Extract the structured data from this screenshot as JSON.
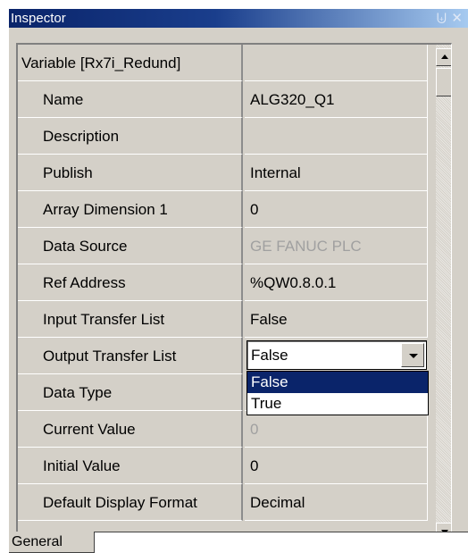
{
  "window": {
    "title": "Inspector",
    "pin_icon": "pin-icon",
    "close_icon": "close-icon"
  },
  "grid": {
    "rows": [
      {
        "name": "Variable [Rx7i_Redund]",
        "value": "",
        "indent": false,
        "disabled": false
      },
      {
        "name": "Name",
        "value": "ALG320_Q1",
        "indent": true,
        "disabled": false
      },
      {
        "name": "Description",
        "value": "",
        "indent": true,
        "disabled": false
      },
      {
        "name": "Publish",
        "value": "Internal",
        "indent": true,
        "disabled": false
      },
      {
        "name": "Array Dimension 1",
        "value": "0",
        "indent": true,
        "disabled": false
      },
      {
        "name": "Data Source",
        "value": "GE FANUC PLC",
        "indent": true,
        "disabled": true
      },
      {
        "name": "Ref Address",
        "value": "%QW0.8.0.1",
        "indent": true,
        "disabled": false
      },
      {
        "name": "Input Transfer List",
        "value": "False",
        "indent": true,
        "disabled": false
      },
      {
        "name": "Output Transfer List",
        "value": "False",
        "indent": true,
        "disabled": false
      },
      {
        "name": "Data Type",
        "value": "",
        "indent": true,
        "disabled": false
      },
      {
        "name": "Current Value",
        "value": "0",
        "indent": true,
        "disabled": true
      },
      {
        "name": "Initial Value",
        "value": "0",
        "indent": true,
        "disabled": false
      },
      {
        "name": "Default Display Format",
        "value": "Decimal",
        "indent": true,
        "disabled": false
      }
    ]
  },
  "dropdown": {
    "current": "False",
    "options": [
      "False",
      "True"
    ],
    "selected": "False"
  },
  "tabs": {
    "general": "General"
  }
}
